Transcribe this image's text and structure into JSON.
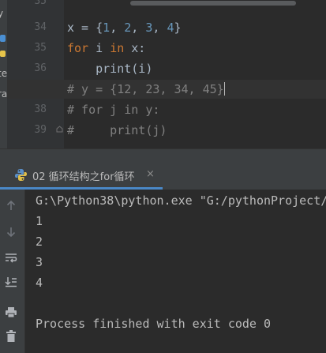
{
  "side_labels": [
    "y",
    "te",
    "ra"
  ],
  "editor": {
    "line_numbers": [
      "35",
      "34",
      "35",
      "36",
      "37",
      "38",
      "39"
    ],
    "active_line": "37",
    "lines": [
      {
        "parts": [
          {
            "t": "x = {",
            "c": "plain"
          },
          {
            "t": "1",
            "c": "num"
          },
          {
            "t": ", ",
            "c": "plain"
          },
          {
            "t": "2",
            "c": "num"
          },
          {
            "t": ", ",
            "c": "plain"
          },
          {
            "t": "3",
            "c": "num"
          },
          {
            "t": ", ",
            "c": "plain"
          },
          {
            "t": "4",
            "c": "num"
          },
          {
            "t": "}",
            "c": "plain"
          }
        ]
      },
      {
        "parts": [
          {
            "t": "for",
            "c": "kw"
          },
          {
            "t": " i ",
            "c": "plain"
          },
          {
            "t": "in",
            "c": "kw"
          },
          {
            "t": " x:",
            "c": "plain"
          }
        ]
      },
      {
        "parts": [
          {
            "t": "    print(i)",
            "c": "plain"
          }
        ]
      },
      {
        "parts": [
          {
            "t": "# y = {12, 23, 34, 45}",
            "c": "cm"
          }
        ]
      },
      {
        "parts": [
          {
            "t": "# for j in y:",
            "c": "cm"
          }
        ]
      },
      {
        "parts": [
          {
            "t": "#     print(j)",
            "c": "cm"
          }
        ]
      }
    ]
  },
  "run_tab": {
    "label": "02 循环结构之for循环",
    "close": "×"
  },
  "console": {
    "lines": [
      "G:\\Python38\\python.exe \"G:/pythonProject/",
      "1",
      "2",
      "3",
      "4",
      "",
      "Process finished with exit code 0"
    ]
  },
  "colors": {
    "keyword": "#cc7832",
    "number": "#6897bb",
    "comment": "#808080",
    "text": "#a9b7c6"
  }
}
